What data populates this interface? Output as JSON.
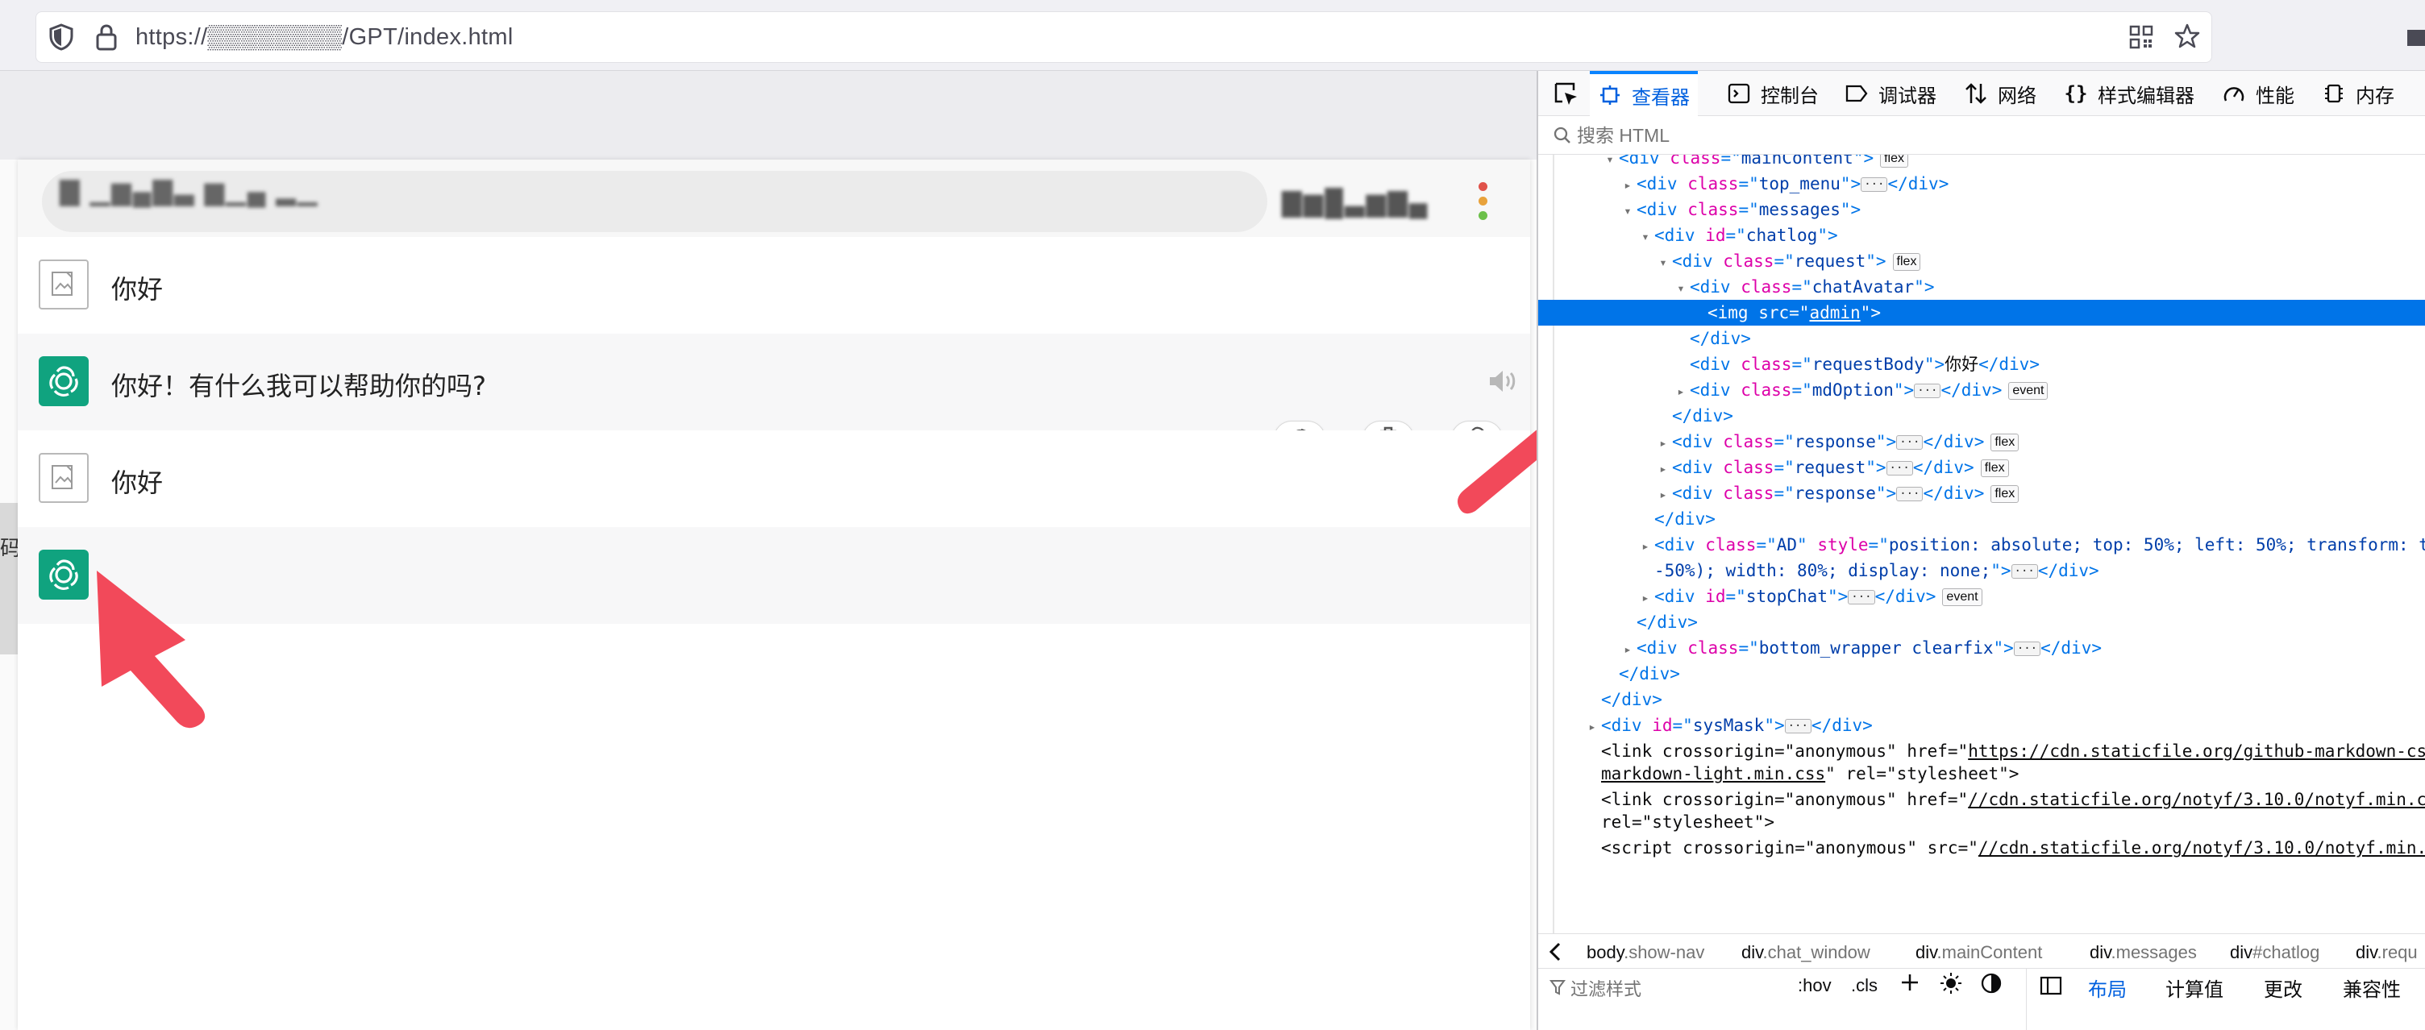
{
  "browser": {
    "url": "https://▒▒▒▒▒▒▒▒/GPT/index.html"
  },
  "chat": {
    "title_redacted": "▇ ▁▆▄▇▃ ▆▁▄ ▂▁",
    "user_redacted": "▇▆█▃▆▇▄",
    "side_tab_label": "码",
    "messages": [
      {
        "role": "user",
        "text": "你好"
      },
      {
        "role": "assistant",
        "text": "你好！有什么我可以帮助你的吗?"
      },
      {
        "role": "user",
        "text": "你好"
      },
      {
        "role": "assistant",
        "text": ""
      }
    ],
    "icons": {
      "refresh": "refresh-icon",
      "delete": "trash-icon",
      "download": "cloud-download-icon",
      "speaker": "speaker-icon"
    }
  },
  "devtools": {
    "tabs": [
      {
        "label": "查看器",
        "icon": "inspector-icon",
        "active": true
      },
      {
        "label": "控制台",
        "icon": "console-icon"
      },
      {
        "label": "调试器",
        "icon": "debugger-icon"
      },
      {
        "label": "网络",
        "icon": "network-icon"
      },
      {
        "label": "样式编辑器",
        "icon": "braces-icon"
      },
      {
        "label": "性能",
        "icon": "performance-icon"
      },
      {
        "label": "内存",
        "icon": "memory-icon"
      }
    ],
    "search_placeholder": "搜索 HTML",
    "tree": {
      "n0": {
        "cls": "mainContent",
        "badge": "flex"
      },
      "n1": {
        "cls": "top_menu"
      },
      "n2": {
        "cls": "messages"
      },
      "n3": {
        "id": "chatlog"
      },
      "n4": {
        "cls": "request",
        "badge": "flex"
      },
      "n5": {
        "cls": "chatAvatar"
      },
      "n6": {
        "src": "admin"
      },
      "n8": {
        "cls": "requestBody",
        "text": "你好"
      },
      "n9": {
        "cls": "mdOption",
        "badge": "event"
      },
      "n11": {
        "cls": "response",
        "badge": "flex"
      },
      "n12": {
        "cls": "request",
        "badge": "flex"
      },
      "n13": {
        "cls": "response",
        "badge": "flex"
      },
      "n15a": {
        "cls": "AD",
        "style": "position: absolute; top: 50%; left: 50%; transform: translate(-50%,"
      },
      "n15b": {
        "style": "-50%); width: 80%; display: none;"
      },
      "n16": {
        "id": "stopChat",
        "badge": "event"
      },
      "n18": {
        "cls": "bottom_wrapper clearfix"
      },
      "n21": {
        "id": "sysMask"
      },
      "n22a": {
        "crossorigin": "anonymous",
        "href": "https://cdn.staticfile.org/github-markdown-css/5.2.0/github-"
      },
      "n22b": {
        "href": "markdown-light.min.css",
        "rel": "stylesheet"
      },
      "n23a": {
        "crossorigin": "anonymous",
        "href": "//cdn.staticfile.org/notyf/3.10.0/notyf.min.css"
      },
      "n23b": {
        "rel": "stylesheet"
      },
      "n24": {
        "crossorigin": "anonymous",
        "src": "//cdn.staticfile.org/notyf/3.10.0/notyf.min.js"
      }
    },
    "breadcrumbs": [
      {
        "tag": "body",
        "cls": ".show-nav"
      },
      {
        "tag": "div",
        "cls": ".chat_window"
      },
      {
        "tag": "div",
        "cls": ".mainContent"
      },
      {
        "tag": "div",
        "cls": ".messages"
      },
      {
        "tag": "div",
        "cls": "#chatlog"
      },
      {
        "tag": "div",
        "cls": ".requ"
      }
    ],
    "rules": {
      "filter_placeholder": "过滤样式",
      "hov": ":hov",
      "cls": ".cls"
    },
    "layout": {
      "tabs": [
        "布局",
        "计算值",
        "更改",
        "兼容性"
      ]
    }
  },
  "colors": {
    "accent": "#0074e8",
    "assistant_avatar": "#10a37f",
    "arrow": "#f2495a"
  }
}
